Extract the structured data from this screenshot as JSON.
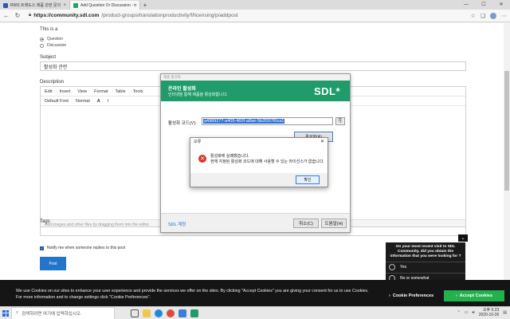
{
  "browser": {
    "tabs": [
      {
        "label": "RWS 트래도스 제품 관련 문의",
        "favicon_color": "#2b5aa8"
      },
      {
        "label": "Add Question Or Discussion - tr",
        "favicon_color": "#22a36a"
      }
    ],
    "url": {
      "host": "https://community.sdl.com",
      "path": "/product-groups/translationproductivity/f/licensing/p/addpost"
    }
  },
  "form": {
    "post_type_label": "This is a",
    "option_question": "Question",
    "option_discussion": "Discussion",
    "subject_label": "Subject",
    "subject_value": "활성화 관련",
    "description_label": "Description",
    "menu": [
      "Edit",
      "Insert",
      "View",
      "Format",
      "Table",
      "Tools"
    ],
    "font_default": "Default Font",
    "font_style": "Normal",
    "drop_hint": "Add images and other files by dragging them into the editor.",
    "tags_label": "Tags",
    "notify_label": "Notify me when someone replies to this post",
    "post_button": "Post"
  },
  "sdl_dialog": {
    "window_title": "제품 활성화",
    "banner_title": "온라인 활성화",
    "banner_subtitle": "인터넷을 통해 제품을 활성화합니다.",
    "logo": "SDL*",
    "key_label": "활성화 코드(V):",
    "key_value": "a4989277-a405-460f-a8ae-5b2f267f0ca1",
    "activate_button": "활성화(A)",
    "link": "SDL 계정",
    "cancel_button": "취소(C)",
    "help_button": "도움말(H)"
  },
  "error_dialog": {
    "title": "오류",
    "message_line1": "활성화에 실패했습니다.",
    "message_line2": "현재 지정된 활성화 코드에 대해 사용할 수 있는 라이선스가 없습니다.",
    "ok_button": "확인"
  },
  "survey": {
    "question": "On your most recent visit to SDL Community, did you obtain the information that you were looking for ?",
    "options": [
      "Yes",
      "No or somewhat"
    ]
  },
  "cookie": {
    "text": "We use Cookies on our sites to enhance your user experience and provide the services we offer on the sites. By clicking \"Accept Cookies\" you are giving your consent for us to use Cookies. For more information and to change settings click \"Cookie Preferences\".",
    "prefs_button": "Cookie Preferences",
    "accept_button": "Accept Cookies"
  },
  "taskbar": {
    "search_placeholder": "검색하려면 여기에 입력하십시오.",
    "time": "오후 5:23",
    "date": "2020-10-26"
  },
  "colors": {
    "sdl_green": "#1f9c6a",
    "accept_green": "#22b14c",
    "post_blue": "#2275c9",
    "error_red": "#d9362b"
  }
}
